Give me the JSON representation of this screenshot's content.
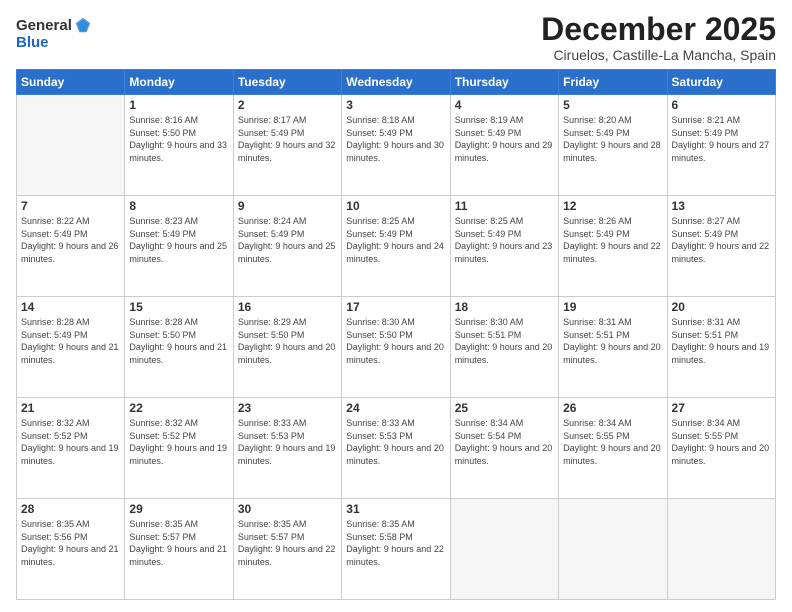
{
  "logo": {
    "general": "General",
    "blue": "Blue"
  },
  "header": {
    "month": "December 2025",
    "location": "Ciruelos, Castille-La Mancha, Spain"
  },
  "weekdays": [
    "Sunday",
    "Monday",
    "Tuesday",
    "Wednesday",
    "Thursday",
    "Friday",
    "Saturday"
  ],
  "weeks": [
    [
      {
        "day": "",
        "sunrise": "",
        "sunset": "",
        "daylight": ""
      },
      {
        "day": "1",
        "sunrise": "Sunrise: 8:16 AM",
        "sunset": "Sunset: 5:50 PM",
        "daylight": "Daylight: 9 hours and 33 minutes."
      },
      {
        "day": "2",
        "sunrise": "Sunrise: 8:17 AM",
        "sunset": "Sunset: 5:49 PM",
        "daylight": "Daylight: 9 hours and 32 minutes."
      },
      {
        "day": "3",
        "sunrise": "Sunrise: 8:18 AM",
        "sunset": "Sunset: 5:49 PM",
        "daylight": "Daylight: 9 hours and 30 minutes."
      },
      {
        "day": "4",
        "sunrise": "Sunrise: 8:19 AM",
        "sunset": "Sunset: 5:49 PM",
        "daylight": "Daylight: 9 hours and 29 minutes."
      },
      {
        "day": "5",
        "sunrise": "Sunrise: 8:20 AM",
        "sunset": "Sunset: 5:49 PM",
        "daylight": "Daylight: 9 hours and 28 minutes."
      },
      {
        "day": "6",
        "sunrise": "Sunrise: 8:21 AM",
        "sunset": "Sunset: 5:49 PM",
        "daylight": "Daylight: 9 hours and 27 minutes."
      }
    ],
    [
      {
        "day": "7",
        "sunrise": "Sunrise: 8:22 AM",
        "sunset": "Sunset: 5:49 PM",
        "daylight": "Daylight: 9 hours and 26 minutes."
      },
      {
        "day": "8",
        "sunrise": "Sunrise: 8:23 AM",
        "sunset": "Sunset: 5:49 PM",
        "daylight": "Daylight: 9 hours and 25 minutes."
      },
      {
        "day": "9",
        "sunrise": "Sunrise: 8:24 AM",
        "sunset": "Sunset: 5:49 PM",
        "daylight": "Daylight: 9 hours and 25 minutes."
      },
      {
        "day": "10",
        "sunrise": "Sunrise: 8:25 AM",
        "sunset": "Sunset: 5:49 PM",
        "daylight": "Daylight: 9 hours and 24 minutes."
      },
      {
        "day": "11",
        "sunrise": "Sunrise: 8:25 AM",
        "sunset": "Sunset: 5:49 PM",
        "daylight": "Daylight: 9 hours and 23 minutes."
      },
      {
        "day": "12",
        "sunrise": "Sunrise: 8:26 AM",
        "sunset": "Sunset: 5:49 PM",
        "daylight": "Daylight: 9 hours and 22 minutes."
      },
      {
        "day": "13",
        "sunrise": "Sunrise: 8:27 AM",
        "sunset": "Sunset: 5:49 PM",
        "daylight": "Daylight: 9 hours and 22 minutes."
      }
    ],
    [
      {
        "day": "14",
        "sunrise": "Sunrise: 8:28 AM",
        "sunset": "Sunset: 5:49 PM",
        "daylight": "Daylight: 9 hours and 21 minutes."
      },
      {
        "day": "15",
        "sunrise": "Sunrise: 8:28 AM",
        "sunset": "Sunset: 5:50 PM",
        "daylight": "Daylight: 9 hours and 21 minutes."
      },
      {
        "day": "16",
        "sunrise": "Sunrise: 8:29 AM",
        "sunset": "Sunset: 5:50 PM",
        "daylight": "Daylight: 9 hours and 20 minutes."
      },
      {
        "day": "17",
        "sunrise": "Sunrise: 8:30 AM",
        "sunset": "Sunset: 5:50 PM",
        "daylight": "Daylight: 9 hours and 20 minutes."
      },
      {
        "day": "18",
        "sunrise": "Sunrise: 8:30 AM",
        "sunset": "Sunset: 5:51 PM",
        "daylight": "Daylight: 9 hours and 20 minutes."
      },
      {
        "day": "19",
        "sunrise": "Sunrise: 8:31 AM",
        "sunset": "Sunset: 5:51 PM",
        "daylight": "Daylight: 9 hours and 20 minutes."
      },
      {
        "day": "20",
        "sunrise": "Sunrise: 8:31 AM",
        "sunset": "Sunset: 5:51 PM",
        "daylight": "Daylight: 9 hours and 19 minutes."
      }
    ],
    [
      {
        "day": "21",
        "sunrise": "Sunrise: 8:32 AM",
        "sunset": "Sunset: 5:52 PM",
        "daylight": "Daylight: 9 hours and 19 minutes."
      },
      {
        "day": "22",
        "sunrise": "Sunrise: 8:32 AM",
        "sunset": "Sunset: 5:52 PM",
        "daylight": "Daylight: 9 hours and 19 minutes."
      },
      {
        "day": "23",
        "sunrise": "Sunrise: 8:33 AM",
        "sunset": "Sunset: 5:53 PM",
        "daylight": "Daylight: 9 hours and 19 minutes."
      },
      {
        "day": "24",
        "sunrise": "Sunrise: 8:33 AM",
        "sunset": "Sunset: 5:53 PM",
        "daylight": "Daylight: 9 hours and 20 minutes."
      },
      {
        "day": "25",
        "sunrise": "Sunrise: 8:34 AM",
        "sunset": "Sunset: 5:54 PM",
        "daylight": "Daylight: 9 hours and 20 minutes."
      },
      {
        "day": "26",
        "sunrise": "Sunrise: 8:34 AM",
        "sunset": "Sunset: 5:55 PM",
        "daylight": "Daylight: 9 hours and 20 minutes."
      },
      {
        "day": "27",
        "sunrise": "Sunrise: 8:34 AM",
        "sunset": "Sunset: 5:55 PM",
        "daylight": "Daylight: 9 hours and 20 minutes."
      }
    ],
    [
      {
        "day": "28",
        "sunrise": "Sunrise: 8:35 AM",
        "sunset": "Sunset: 5:56 PM",
        "daylight": "Daylight: 9 hours and 21 minutes."
      },
      {
        "day": "29",
        "sunrise": "Sunrise: 8:35 AM",
        "sunset": "Sunset: 5:57 PM",
        "daylight": "Daylight: 9 hours and 21 minutes."
      },
      {
        "day": "30",
        "sunrise": "Sunrise: 8:35 AM",
        "sunset": "Sunset: 5:57 PM",
        "daylight": "Daylight: 9 hours and 22 minutes."
      },
      {
        "day": "31",
        "sunrise": "Sunrise: 8:35 AM",
        "sunset": "Sunset: 5:58 PM",
        "daylight": "Daylight: 9 hours and 22 minutes."
      },
      {
        "day": "",
        "sunrise": "",
        "sunset": "",
        "daylight": ""
      },
      {
        "day": "",
        "sunrise": "",
        "sunset": "",
        "daylight": ""
      },
      {
        "day": "",
        "sunrise": "",
        "sunset": "",
        "daylight": ""
      }
    ]
  ]
}
